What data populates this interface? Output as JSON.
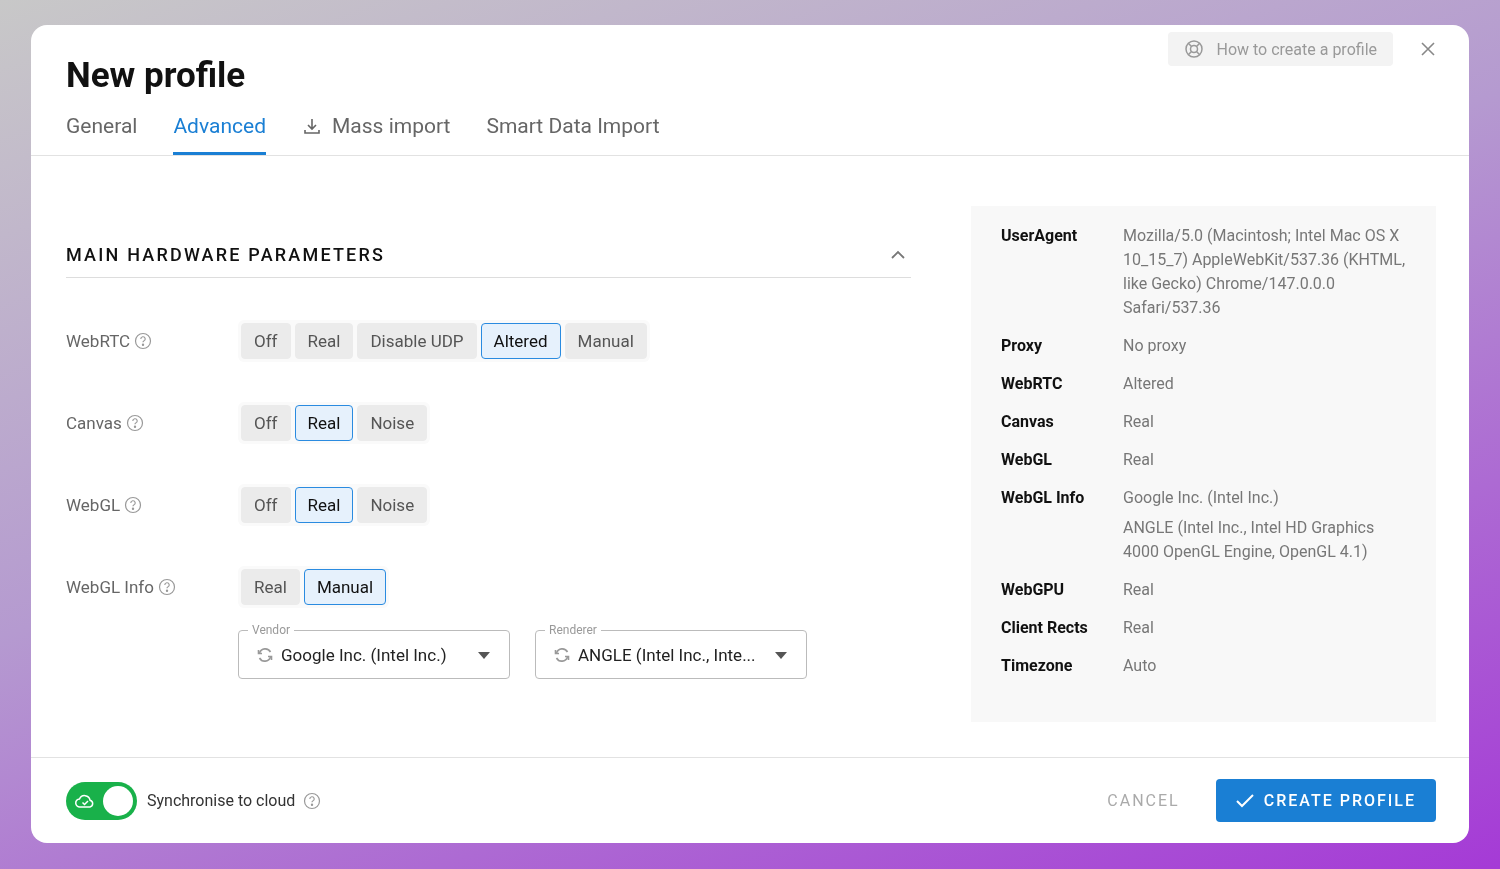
{
  "title": "New profile",
  "help_button": "How to create a profile",
  "tabs": [
    {
      "label": "General",
      "selected": false
    },
    {
      "label": "Advanced",
      "selected": true
    },
    {
      "label": "Mass import",
      "selected": false,
      "kind": "download"
    },
    {
      "label": "Smart Data Import",
      "selected": false
    }
  ],
  "section": {
    "title": "MAIN HARDWARE PARAMETERS",
    "expanded": true
  },
  "params": [
    {
      "label": "WebRTC",
      "options": [
        {
          "label": "Off",
          "selected": false
        },
        {
          "label": "Real",
          "selected": false
        },
        {
          "label": "Disable UDP",
          "selected": false
        },
        {
          "label": "Altered",
          "selected": true
        },
        {
          "label": "Manual",
          "selected": false
        }
      ]
    },
    {
      "label": "Canvas",
      "options": [
        {
          "label": "Off",
          "selected": false
        },
        {
          "label": "Real",
          "selected": true
        },
        {
          "label": "Noise",
          "selected": false
        }
      ]
    },
    {
      "label": "WebGL",
      "options": [
        {
          "label": "Off",
          "selected": false
        },
        {
          "label": "Real",
          "selected": true
        },
        {
          "label": "Noise",
          "selected": false
        }
      ]
    },
    {
      "label": "WebGL Info",
      "options": [
        {
          "label": "Real",
          "selected": false
        },
        {
          "label": "Manual",
          "selected": true
        }
      ]
    }
  ],
  "selects": [
    {
      "label": "Vendor",
      "value": "Google Inc. (Intel Inc.)"
    },
    {
      "label": "Renderer",
      "value": "ANGLE (Intel Inc., Inte..."
    }
  ],
  "summary": [
    {
      "label": "UserAgent",
      "values": [
        "Mozilla/5.0 (Macintosh; Intel Mac OS X 10_15_7) AppleWebKit/537.36 (KHTML, like Gecko) Chrome/147.0.0.0 Safari/537.36"
      ]
    },
    {
      "label": "Proxy",
      "values": [
        "No proxy"
      ]
    },
    {
      "label": "WebRTC",
      "values": [
        "Altered"
      ]
    },
    {
      "label": "Canvas",
      "values": [
        "Real"
      ]
    },
    {
      "label": "WebGL",
      "values": [
        "Real"
      ]
    },
    {
      "label": "WebGL Info",
      "values": [
        "Google Inc. (Intel Inc.)",
        "ANGLE (Intel Inc., Intel HD Graphics 4000 OpenGL Engine, OpenGL 4.1)"
      ]
    },
    {
      "label": "WebGPU",
      "values": [
        "Real"
      ]
    },
    {
      "label": "Client Rects",
      "values": [
        "Real"
      ]
    },
    {
      "label": "Timezone",
      "values": [
        "Auto"
      ]
    }
  ],
  "sync": {
    "label": "Synchronise to cloud",
    "on": true
  },
  "cancel": "CANCEL",
  "create": "CREATE PROFILE"
}
